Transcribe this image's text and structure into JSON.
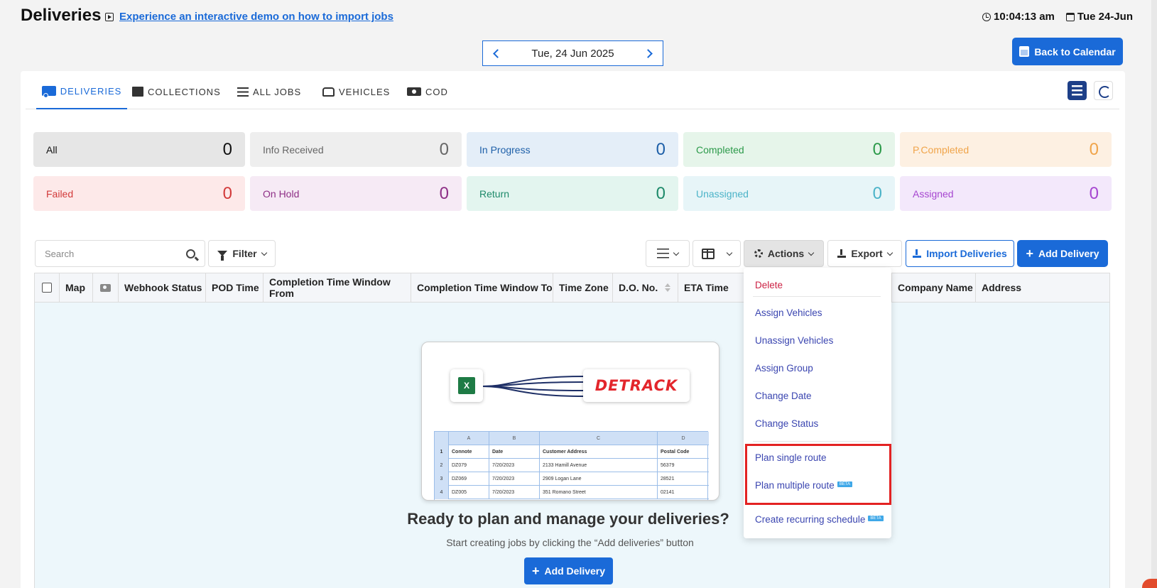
{
  "header": {
    "title": "Deliveries",
    "demo_link": "Experience an interactive demo on how to import jobs",
    "time": "10:04:13 am",
    "date_short": "Tue 24-Jun"
  },
  "date_nav": {
    "label": "Tue, 24 Jun 2025"
  },
  "back_to_calendar": "Back to Calendar",
  "tabs": [
    {
      "label": "DELIVERIES",
      "icon": "truck-icon",
      "active": true
    },
    {
      "label": "COLLECTIONS",
      "icon": "box-icon"
    },
    {
      "label": "ALL JOBS",
      "icon": "list-icon"
    },
    {
      "label": "VEHICLES",
      "icon": "car-icon"
    },
    {
      "label": "COD",
      "icon": "money-icon"
    }
  ],
  "status_tiles": [
    {
      "label": "All",
      "count": "0",
      "bg": "#e6e6e6",
      "color": "#111"
    },
    {
      "label": "Info Received",
      "count": "0",
      "bg": "#eeeeee",
      "color": "#666"
    },
    {
      "label": "In Progress",
      "count": "0",
      "bg": "#e4eef8",
      "color": "#1d5fa8"
    },
    {
      "label": "Completed",
      "count": "0",
      "bg": "#e6f5ea",
      "color": "#2c9a4a"
    },
    {
      "label": "P.Completed",
      "count": "0",
      "bg": "#fdf0e2",
      "color": "#f0a44a"
    },
    {
      "label": "Failed",
      "count": "0",
      "bg": "#fde9e9",
      "color": "#d23a3a"
    },
    {
      "label": "On Hold",
      "count": "0",
      "bg": "#f6eaf5",
      "color": "#8e2f86"
    },
    {
      "label": "Return",
      "count": "0",
      "bg": "#e3f5ef",
      "color": "#1e8a6a"
    },
    {
      "label": "Unassigned",
      "count": "0",
      "bg": "#e7f5f8",
      "color": "#4bb3c8"
    },
    {
      "label": "Assigned",
      "count": "0",
      "bg": "#f3e8fb",
      "color": "#a646d0"
    }
  ],
  "toolbar": {
    "search_placeholder": "Search",
    "filter": "Filter",
    "actions": "Actions",
    "export": "Export",
    "import": "Import Deliveries",
    "add": "Add Delivery"
  },
  "table": {
    "columns": [
      "Map",
      "Webhook Status",
      "POD Time",
      "Completion Time Window From",
      "Completion Time Window To",
      "Time Zone",
      "D.O. No.",
      "ETA Time",
      "Company Name",
      "Address"
    ]
  },
  "empty_state": {
    "excel_letter": "X",
    "logo_text": "DETRACK",
    "sheet": {
      "col_letters": [
        "A",
        "B",
        "C",
        "D"
      ],
      "header_row": {
        "num": "1",
        "cells": [
          "Connote",
          "Date",
          "Customer Address",
          "Postal Code"
        ]
      },
      "rows": [
        {
          "num": "2",
          "cells": [
            "DZ079",
            "7/20/2023",
            "2133 Hamill Avenue",
            "56379"
          ]
        },
        {
          "num": "3",
          "cells": [
            "DZ069",
            "7/20/2023",
            "2909 Logan Lane",
            "28521"
          ]
        },
        {
          "num": "4",
          "cells": [
            "DZ005",
            "7/20/2023",
            "351 Romano Street",
            "02141"
          ]
        }
      ]
    },
    "heading": "Ready to plan and manage your deliveries?",
    "subtext": "Start creating jobs by clicking the “Add deliveries” button",
    "button": "Add Delivery"
  },
  "actions_menu": {
    "delete": "Delete",
    "assign_vehicles": "Assign Vehicles",
    "unassign_vehicles": "Unassign Vehicles",
    "assign_group": "Assign Group",
    "change_date": "Change Date",
    "change_status": "Change Status",
    "plan_single": "Plan single route",
    "plan_multiple": "Plan multiple route",
    "create_recurring": "Create recurring schedule",
    "beta": "BETA"
  }
}
